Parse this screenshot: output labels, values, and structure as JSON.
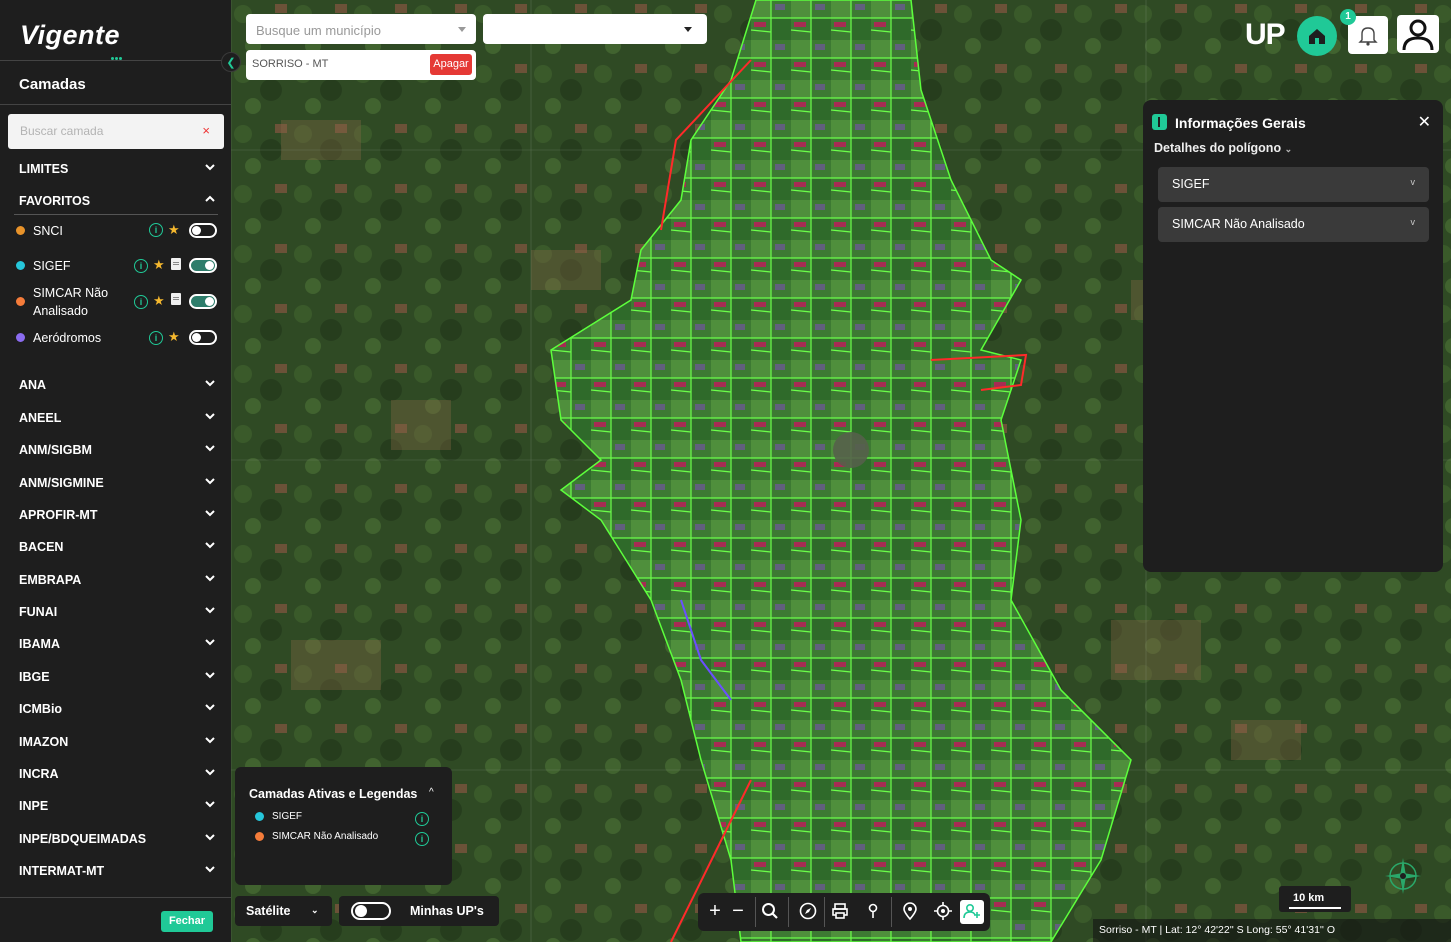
{
  "app": {
    "logo_text": "Vigente",
    "up_logo": "UP",
    "notification_count": "1"
  },
  "sidebar": {
    "title": "Camadas",
    "search_placeholder": "Buscar camada",
    "search_clear": "×",
    "limites": "LIMITES",
    "favoritos": "FAVORITOS",
    "favorites": [
      {
        "label": "SNCI",
        "color": "#e8932a",
        "enabled": false,
        "has_doc": false
      },
      {
        "label": "SIGEF",
        "color": "#26c6da",
        "enabled": true,
        "has_doc": true
      },
      {
        "label": "SIMCAR Não Analisado",
        "color": "#f57c3a",
        "enabled": true,
        "has_doc": true
      },
      {
        "label": "Aeródromos",
        "color": "#8b6cf0",
        "enabled": false,
        "has_doc": false
      }
    ],
    "categories": [
      "ANA",
      "ANEEL",
      "ANM/SIGBM",
      "ANM/SIGMINE",
      "APROFIR-MT",
      "BACEN",
      "EMBRAPA",
      "FUNAI",
      "IBAMA",
      "IBGE",
      "ICMBio",
      "IMAZON",
      "INCRA",
      "INPE",
      "INPE/BDQUEIMADAS",
      "INTERMAT-MT"
    ],
    "close_button": "Fechar"
  },
  "search": {
    "municipio_placeholder": "Busque um município",
    "selected_municipio": "SORRISO - MT",
    "delete_button": "Apagar"
  },
  "info_panel": {
    "title": "Informações Gerais",
    "subtitle": "Detalhes do polígono",
    "sections": [
      "SIGEF",
      "SIMCAR Não Analisado"
    ]
  },
  "legend": {
    "title": "Camadas Ativas e Legendas",
    "items": [
      {
        "label": "SIGEF",
        "color": "#26c6da"
      },
      {
        "label": "SIMCAR Não Analisado",
        "color": "#f57c3a"
      }
    ]
  },
  "bottom": {
    "basemap": "Satélite",
    "my_ups": "Minhas UP's",
    "scale": "10 km",
    "coordinates": "Sorriso - MT | Lat: 12° 42'22'' S Long: 55° 41'31'' O"
  },
  "colors": {
    "accent": "#20c997",
    "panel": "#1e1e1e",
    "danger": "#e53935"
  }
}
